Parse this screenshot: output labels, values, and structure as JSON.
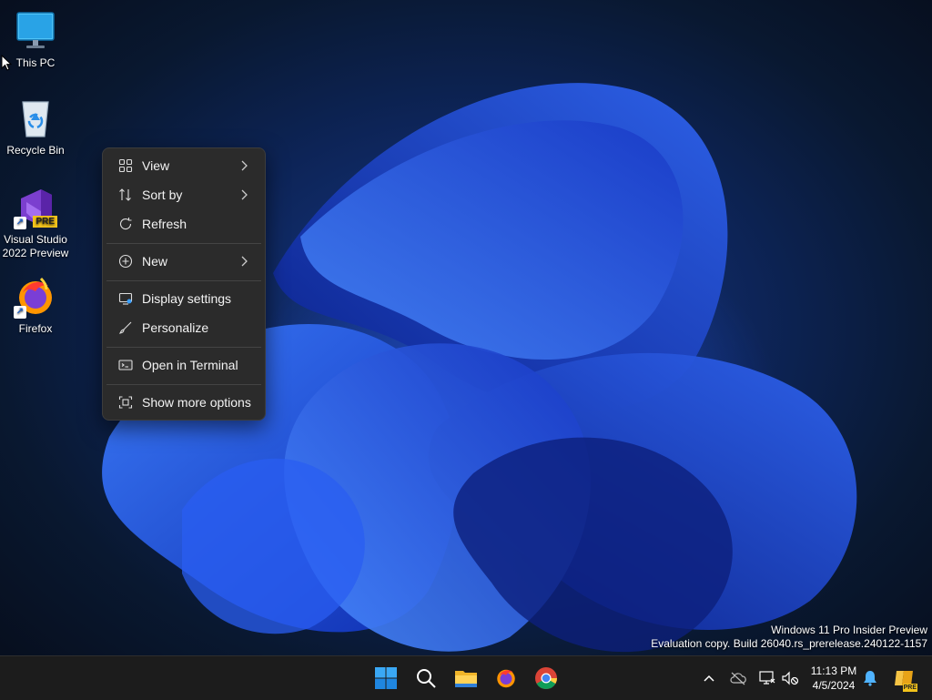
{
  "desktop": {
    "icons": [
      {
        "label": "This PC",
        "icon": "monitor-icon"
      },
      {
        "label": "Recycle Bin",
        "icon": "recycle-bin-icon"
      },
      {
        "label": "Visual Studio 2022 Preview",
        "icon": "visual-studio-icon",
        "badge": "PRE"
      },
      {
        "label": "Firefox",
        "icon": "firefox-icon"
      }
    ]
  },
  "context_menu": {
    "items": [
      {
        "label": "View",
        "icon": "grid-icon",
        "submenu": true
      },
      {
        "label": "Sort by",
        "icon": "sort-icon",
        "submenu": true
      },
      {
        "label": "Refresh",
        "icon": "refresh-icon",
        "submenu": false
      },
      {
        "label": "New",
        "icon": "plus-circle-icon",
        "submenu": true
      },
      {
        "label": "Display settings",
        "icon": "display-icon",
        "submenu": false
      },
      {
        "label": "Personalize",
        "icon": "brush-icon",
        "submenu": false
      },
      {
        "label": "Open in Terminal",
        "icon": "terminal-icon",
        "submenu": false
      },
      {
        "label": "Show more options",
        "icon": "expand-icon",
        "submenu": false
      }
    ]
  },
  "watermark": {
    "line1": "Windows 11 Pro Insider Preview",
    "line2": "Evaluation copy. Build 26040.rs_prerelease.240122-1157"
  },
  "taskbar": {
    "pinned": [
      "start-icon",
      "search-icon",
      "file-explorer-icon",
      "firefox-icon",
      "chrome-icon"
    ],
    "clock": {
      "time": "11:13 PM",
      "date": "4/5/2024"
    },
    "copilot_badge": "PRE"
  },
  "colors": {
    "menu_bg": "#2b2b2b",
    "taskbar_bg": "#1c1c1c",
    "accent": "#1f7bd8"
  }
}
